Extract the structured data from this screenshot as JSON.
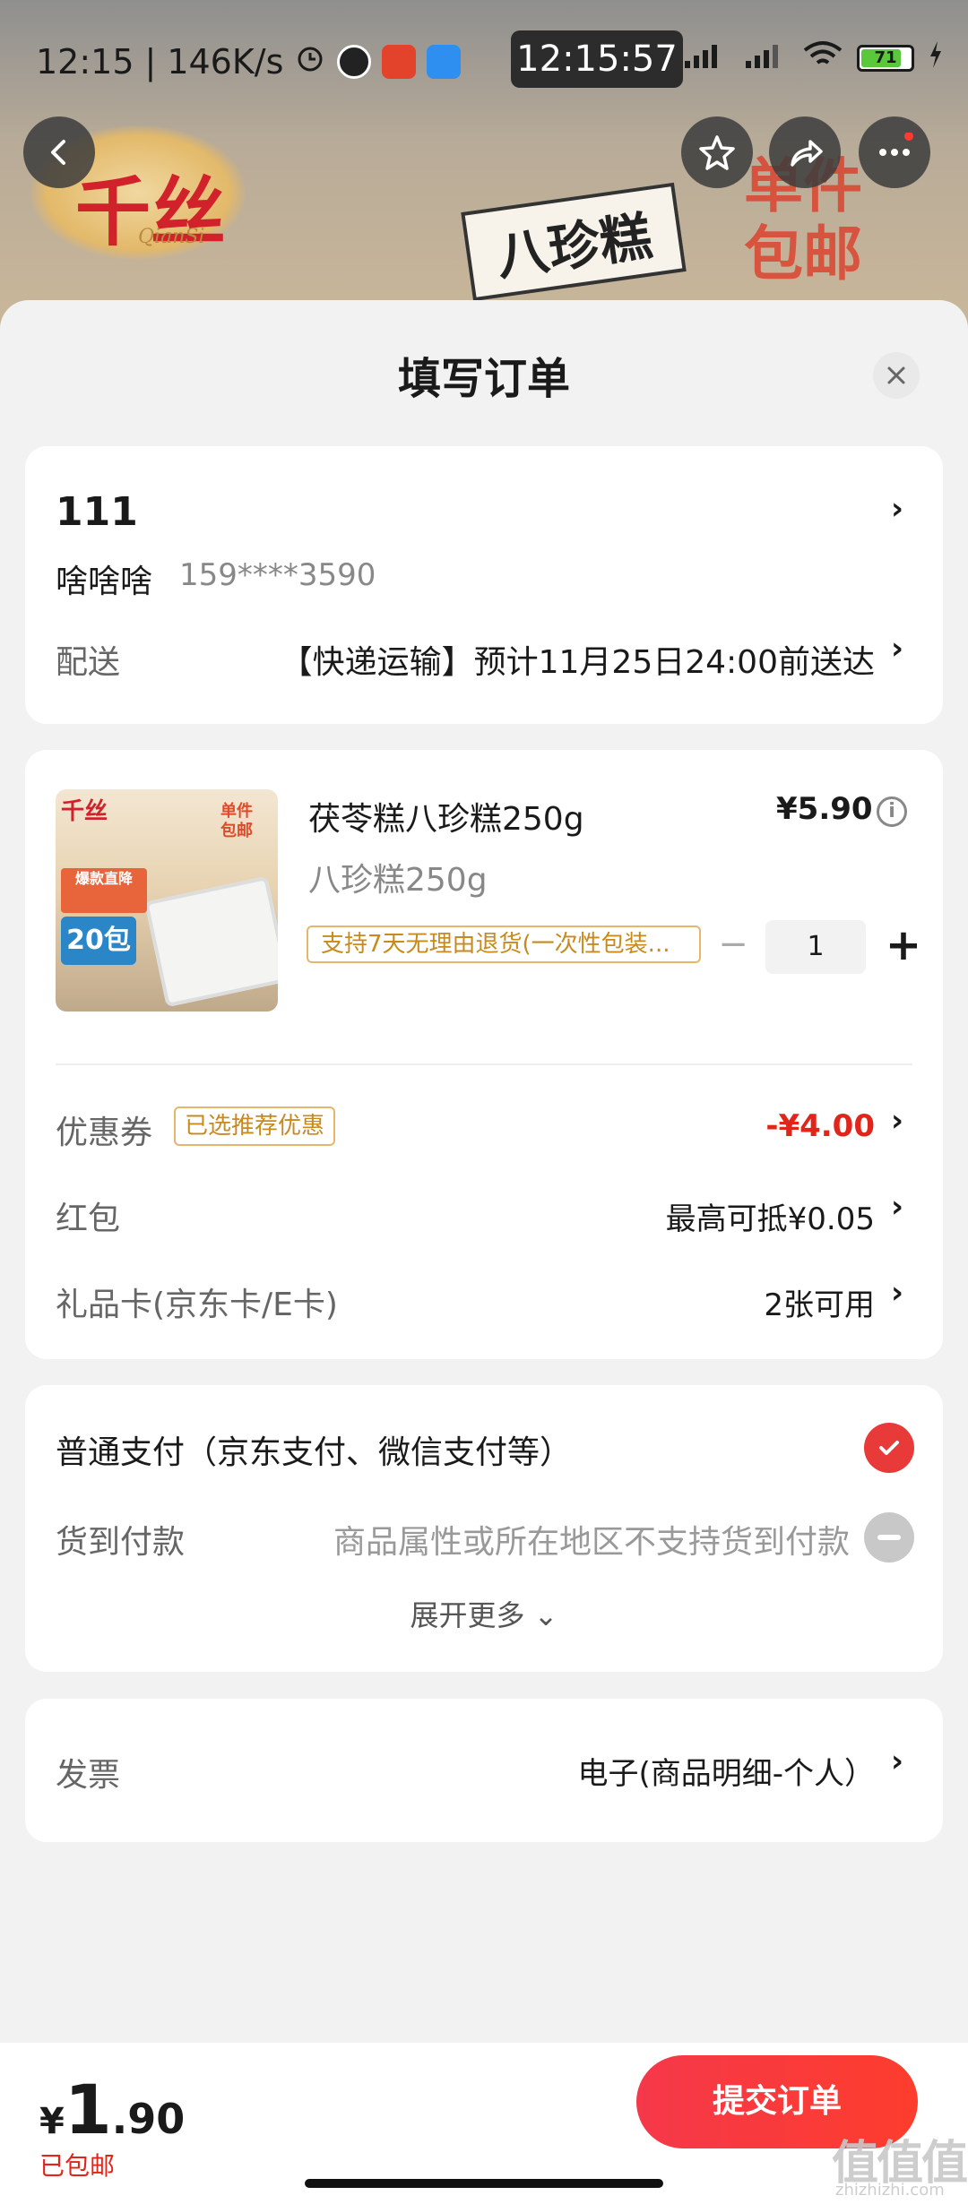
{
  "status_bar": {
    "time": "12:15",
    "speed": "146K/s",
    "clock_overlay": "12:15:57",
    "battery": "71"
  },
  "hero": {
    "brand_logo_text": "千丝",
    "brand_logo_sub": "QianSi",
    "promo_stamp_line1": "单件",
    "promo_stamp_line2": "包邮",
    "box_label": "八珍糕"
  },
  "sheet": {
    "title": "填写订单"
  },
  "address": {
    "title": "111",
    "name": "啥啥啥",
    "phone": "159****3590",
    "shipping_label": "配送",
    "shipping_value": "【快递运输】预计11月25日24:00前送达"
  },
  "product": {
    "image_logo": "千丝",
    "image_stamp": "单件包邮",
    "image_tag1": "爆款直降",
    "image_tag2": "20包",
    "name": "茯苓糕八珍糕250g",
    "price": "¥5.90",
    "spec": "八珍糕250g",
    "return_policy": "支持7天无理由退货(一次性包装...",
    "quantity": "1",
    "minus_symbol": "−",
    "plus_symbol": "+"
  },
  "discounts": {
    "coupon_label": "优惠券",
    "coupon_chip": "已选推荐优惠",
    "coupon_value": "-¥4.00",
    "redpacket_label": "红包",
    "redpacket_value": "最高可抵¥0.05",
    "giftcard_label": "礼品卡(京东卡/E卡)",
    "giftcard_value": "2张可用"
  },
  "payment": {
    "normal_label": "普通支付（京东支付、微信支付等）",
    "cod_label": "货到付款",
    "cod_note": "商品属性或所在地区不支持货到付款",
    "expand_label": "展开更多 ⌄"
  },
  "invoice": {
    "label": "发票",
    "value": "电子(商品明细-个人）"
  },
  "footer": {
    "currency": "¥",
    "total_integer": "1",
    "total_decimal": ".90",
    "free_shipping": "已包邮",
    "submit_label": "提交订单"
  },
  "watermark": {
    "text": "值值值",
    "url": "zhizhizhi.com"
  },
  "colors": {
    "accent_red": "#e1251b",
    "submit_gradient_start": "#f5384a",
    "submit_gradient_end": "#fd3d2d",
    "chip_gold": "#c88a1e"
  }
}
